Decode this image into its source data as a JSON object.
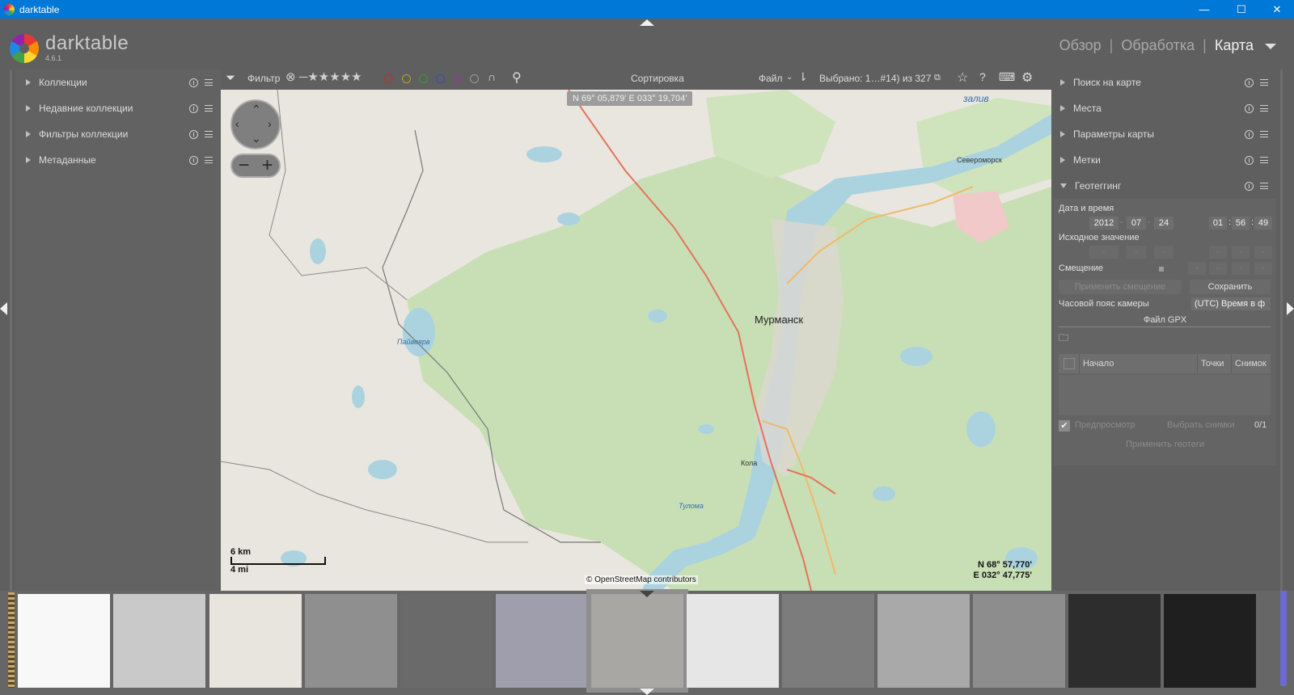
{
  "window": {
    "title": "darktable",
    "minimize": "—",
    "maximize": "☐",
    "close": "✕"
  },
  "app": {
    "name": "darktable",
    "version": "4.6.1"
  },
  "views": [
    {
      "label": "Обзор",
      "active": false
    },
    {
      "label": "Обработка",
      "active": false
    },
    {
      "label": "Карта",
      "active": true
    }
  ],
  "view_sep": "|",
  "left_modules": [
    {
      "label": "Коллекции"
    },
    {
      "label": "Недавние коллекции"
    },
    {
      "label": "Фильтры коллекции"
    },
    {
      "label": "Метаданные"
    }
  ],
  "toolbar": {
    "filter_label": "Фильтр",
    "stars": "⊗ ─★★★★★",
    "sort_label": "Сортировка",
    "sort_value": "Файл",
    "selected": "Выбрано: 1…#14) из 327"
  },
  "color_labels": [
    "#c03030",
    "#c0a020",
    "#30a030",
    "#3050c0",
    "#a030a0",
    "#9a9a9a"
  ],
  "map": {
    "coord_tooltip": "N 69° 05,879' E 033° 19,704'",
    "city_main": "Мурманск",
    "city_severomorsk": "Североморск",
    "city_kola": "Кола",
    "water_zaliv": "залив",
    "water_lake": "Пайвеярв",
    "water_tuloma": "Тулома",
    "scale_km": "6 km",
    "scale_mi": "4 mi",
    "attribution": "© OpenStreetMap contributors",
    "lat": "N 68° 57,770'",
    "lon": "E 032° 47,775'"
  },
  "right_modules": [
    {
      "label": "Поиск на карте"
    },
    {
      "label": "Места"
    },
    {
      "label": "Параметры карты"
    },
    {
      "label": "Метки"
    },
    {
      "label": "Геотеггинг"
    }
  ],
  "geotag": {
    "datetime_label": "Дата и время",
    "year": "2012",
    "month": "07",
    "day": "24",
    "hour": "01",
    "minute": "56",
    "second": "49",
    "original_label": "Исходное значение",
    "offset_label": "Смещение",
    "apply_offset": "Применить смещение",
    "save": "Сохранить",
    "tz_label": "Часовой пояс камеры",
    "tz_value": "(UTC) Время в ф",
    "gpx_label": "Файл GPX",
    "col_start": "Начало",
    "col_points": "Точки",
    "col_shot": "Снимок",
    "preview": "Предпросмотр",
    "select_shots": "Выбрать снимки",
    "count": "0/1",
    "apply_geotags": "Применить геотеги"
  },
  "thumbs": [
    "#f8f8f8",
    "#c9c9c9",
    "#e8e4de",
    "#8f8f8f",
    "#6a6a6a",
    "#9e9eac",
    "#a8a7a4",
    "#e6e6e6",
    "#7c7c7c",
    "#a9a9a9",
    "#8d8d8d",
    "#2d2d2d",
    "#1f1f1f"
  ]
}
